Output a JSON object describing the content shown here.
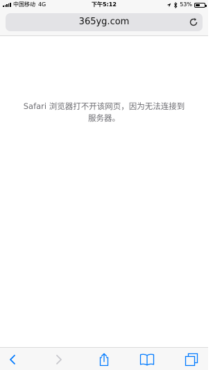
{
  "status_bar": {
    "carrier": "中国移动",
    "network": "4G",
    "time": "下午5:12",
    "battery_percent": "53%",
    "battery_level": 0.53,
    "signal_bars": 5
  },
  "url_bar": {
    "url": "365yg.com",
    "reload_icon": "reload-icon"
  },
  "page": {
    "error_message": "Safari 浏览器打不开该网页，因为无法连接到服务器。"
  },
  "toolbar": {
    "back_icon": "chevron-left-icon",
    "forward_icon": "chevron-right-icon",
    "share_icon": "share-icon",
    "bookmarks_icon": "book-icon",
    "tabs_icon": "tabs-icon"
  },
  "colors": {
    "accent": "#007aff",
    "disabled": "#c7c7cc",
    "message_text": "#6d6d72"
  }
}
